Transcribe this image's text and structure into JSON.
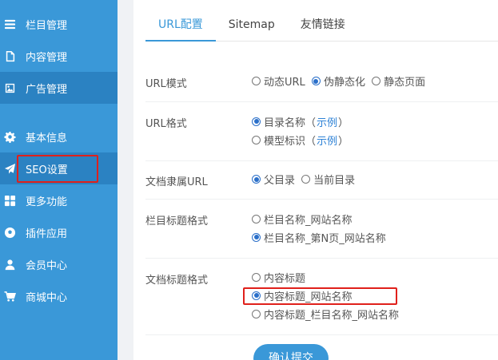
{
  "sidebar": {
    "items": [
      {
        "label": "栏目管理",
        "icon": "menu-icon"
      },
      {
        "label": "内容管理",
        "icon": "document-icon"
      },
      {
        "label": "广告管理",
        "icon": "image-icon"
      },
      {
        "label": "基本信息",
        "icon": "gear-icon"
      },
      {
        "label": "SEO设置",
        "icon": "paper-plane-icon"
      },
      {
        "label": "更多功能",
        "icon": "grid-icon"
      },
      {
        "label": "插件应用",
        "icon": "soccer-ball-icon"
      },
      {
        "label": "会员中心",
        "icon": "user-icon"
      },
      {
        "label": "商城中心",
        "icon": "cart-icon"
      }
    ],
    "active": "SEO设置"
  },
  "tabs": [
    {
      "label": "URL配置",
      "active": true
    },
    {
      "label": "Sitemap",
      "active": false
    },
    {
      "label": "友情链接",
      "active": false
    }
  ],
  "settings": {
    "url_mode": {
      "label": "URL模式",
      "options": [
        "动态URL",
        "伪静态化",
        "静态页面"
      ],
      "selected": "伪静态化"
    },
    "url_format": {
      "label": "URL格式",
      "options": [
        "目录名称",
        "模型标识"
      ],
      "example_label": "示例",
      "paren_open": "（",
      "paren_close": "）",
      "selected": "目录名称"
    },
    "doc_url": {
      "label": "文档隶属URL",
      "options": [
        "父目录",
        "当前目录"
      ],
      "selected": "父目录"
    },
    "column_title": {
      "label": "栏目标题格式",
      "options": [
        "栏目名称_网站名称",
        "栏目名称_第N页_网站名称"
      ],
      "selected": "栏目名称_第N页_网站名称"
    },
    "doc_title": {
      "label": "文档标题格式",
      "options": [
        "内容标题",
        "内容标题_网站名称",
        "内容标题_栏目名称_网站名称"
      ],
      "selected": "内容标题_网站名称"
    }
  },
  "submit_label": "确认提交",
  "colors": {
    "sidebar": "#3a98d8",
    "sidebar_active": "#2b82c2",
    "accent": "#3a98d8",
    "highlight": "#e0201b",
    "radio_selected": "#2a6fc9"
  }
}
